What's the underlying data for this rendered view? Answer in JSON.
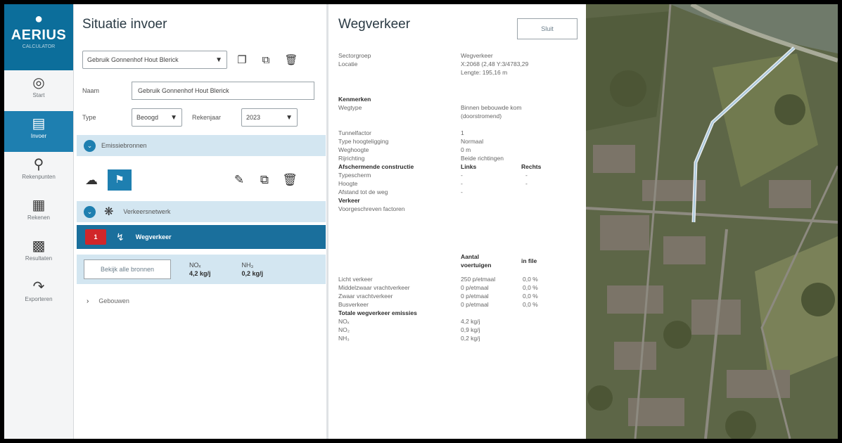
{
  "nav": {
    "brand": "AERIUS",
    "brand_sub": "CALCULATOR",
    "items": [
      {
        "label": "Start",
        "icon": "target-icon"
      },
      {
        "label": "Invoer",
        "icon": "clipboard-icon"
      },
      {
        "label": "Rekenpunten",
        "icon": "map-pin-icon"
      },
      {
        "label": "Rekenen",
        "icon": "calculator-icon"
      },
      {
        "label": "Resultaten",
        "icon": "bar-chart-icon"
      },
      {
        "label": "Exporteren",
        "icon": "export-icon"
      }
    ]
  },
  "situatie": {
    "title": "Situatie invoer",
    "selected": "Gebruik Gonnenhof Hout Blerick",
    "naam_label": "Naam",
    "naam_value": "Gebruik Gonnenhof Hout Blerick",
    "type_label": "Type",
    "type_value": "Beoogd",
    "rekenjaar_label": "Rekenjaar",
    "rekenjaar_value": "2023",
    "emissiebronnen": "Emissiebronnen",
    "verkeersnetwerk": "Verkeersnetwerk",
    "wegverkeer_item": "Wegverkeer",
    "badge": "1",
    "btn_alle": "Bekijk alle bronnen",
    "nox_label": "NOₓ",
    "nox_value": "4,2 kg/j",
    "nh3_label": "NH₃",
    "nh3_value": "0,2 kg/j",
    "gebouwen": "Gebouwen"
  },
  "weg": {
    "title": "Wegverkeer",
    "sluit": "Sluit",
    "sectorgroep_label": "Sectorgroep",
    "sectorgroep_value": "Wegverkeer",
    "locatie_label": "Locatie",
    "locatie_value": "X:2068 (2,48 Y:3/4783,29",
    "lengte_value": "Lengte: 195,16 m",
    "kenmerken": "Kenmerken",
    "wegtype_label": "Wegtype",
    "wegtype_value": "Binnen bebouwde kom",
    "wegtype_value2": "(doorstromend)",
    "tunnel_label": "Tunnelfactor",
    "tunnel_value": "1",
    "hoogte_label": "Type hoogteligging",
    "hoogte_value": "Normaal",
    "weghoogte_label": "Weghoogte",
    "weghoogte_value": "0 m",
    "richting_label": "Rijrichting",
    "richting_value": "Beide richtingen",
    "afsch": "Afschermende constructie",
    "links": "Links",
    "rechts": "Rechts",
    "typescherm": "Typescherm",
    "hoogte": "Hoogte",
    "afstand": "Afstand tot de weg",
    "dash": "-",
    "verkeer": "Verkeer",
    "voorgeschreven": "Voorgeschreven factoren",
    "aantal": "Aantal",
    "voertuigen": "voertuigen",
    "infile": "in file",
    "rows": [
      {
        "label": "Licht verkeer",
        "value": "250 p/etmaal",
        "pct": "0,0 %"
      },
      {
        "label": "Middelzwaar vrachtverkeer",
        "value": "0 p/etmaal",
        "pct": "0,0 %"
      },
      {
        "label": "Zwaar vrachtverkeer",
        "value": "0 p/etmaal",
        "pct": "0,0 %"
      },
      {
        "label": "Busverkeer",
        "value": "0 p/etmaal",
        "pct": "0,0 %"
      }
    ],
    "totale": "Totale wegverkeer emissies",
    "em": [
      {
        "label": "NOₓ",
        "value": "4,2 kg/j"
      },
      {
        "label": "NO₂",
        "value": "0,9 kg/j"
      },
      {
        "label": "NH₃",
        "value": "0,2 kg/j"
      }
    ]
  }
}
